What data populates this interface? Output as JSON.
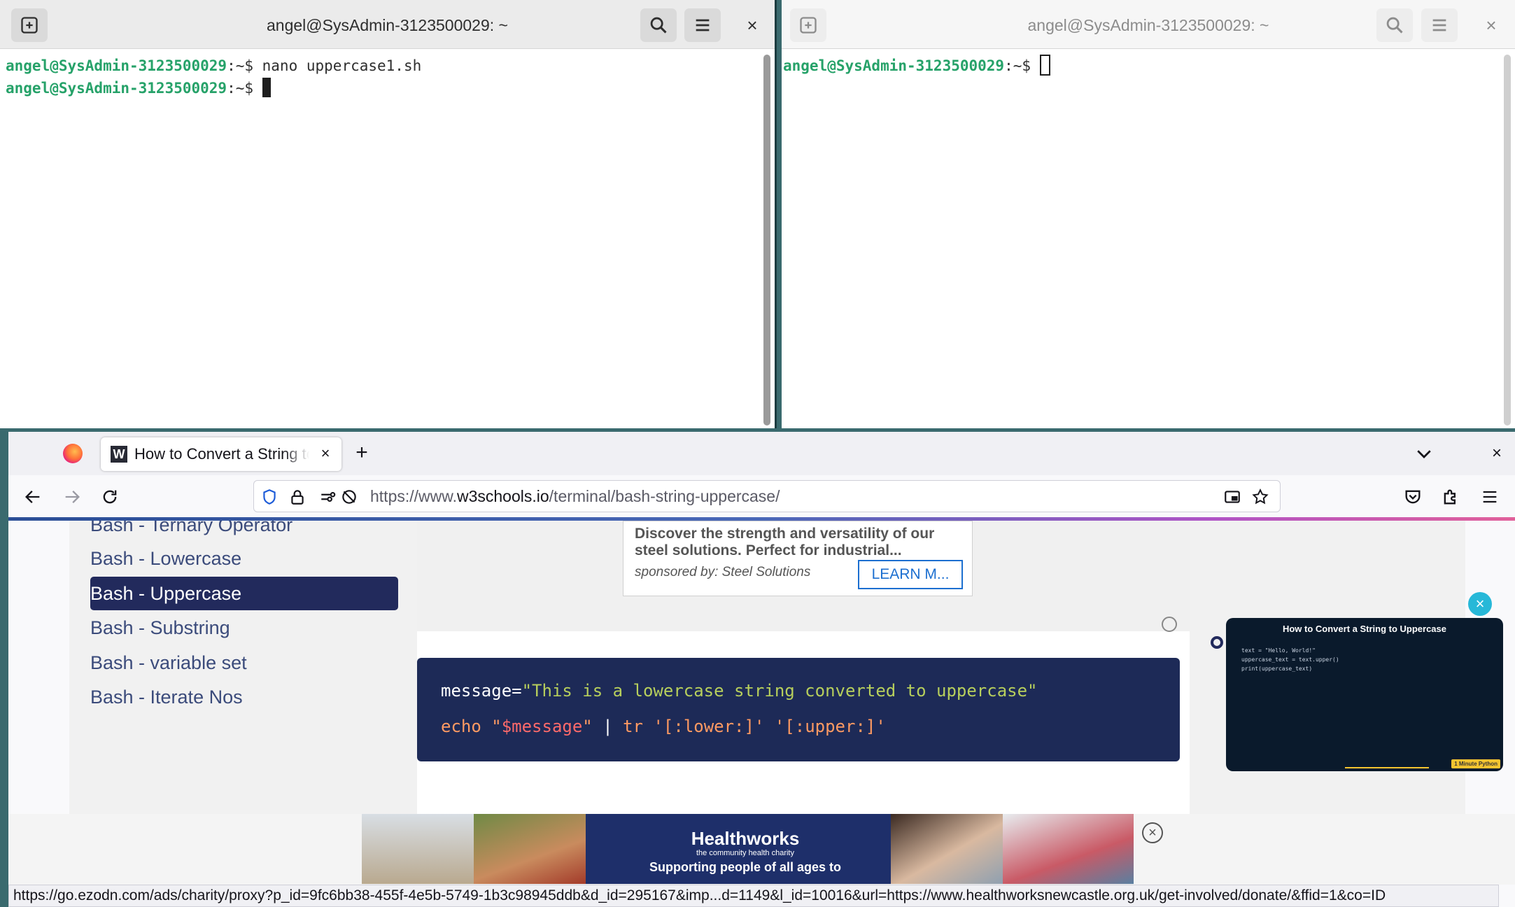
{
  "terminal_left": {
    "title": "angel@SysAdmin-3123500029: ~",
    "lines": [
      {
        "user": "angel@SysAdmin-3123500029",
        "rest": ":~$ nano uppercase1.sh"
      },
      {
        "user": "angel@SysAdmin-3123500029",
        "rest": ":~$ "
      }
    ],
    "close": "×"
  },
  "terminal_right": {
    "title": "angel@SysAdmin-3123500029: ~",
    "lines": [
      {
        "user": "angel@SysAdmin-3123500029",
        "rest": ":~$ "
      }
    ],
    "close": "×"
  },
  "browser": {
    "tab": {
      "favicon": "W",
      "title": "How to Convert a String to Uppercase",
      "close": "×"
    },
    "newtab": "+",
    "window_close": "×",
    "url": {
      "prefix": "https://www.",
      "host": "w3schools.io",
      "path": "/terminal/bash-string-uppercase/"
    },
    "sidebar": {
      "items": [
        {
          "label": "Bash - Ternary Operator"
        },
        {
          "label": "Bash - Lowercase"
        },
        {
          "label": "Bash - Uppercase"
        },
        {
          "label": "Bash - Substring"
        },
        {
          "label": "Bash - variable set"
        },
        {
          "label": "Bash - Iterate Nos"
        }
      ],
      "active_index": 2
    },
    "ad": {
      "description": "Discover the strength and versatility of our steel solutions. Perfect for industrial...",
      "sponsor": "sponsored by: Steel Solutions",
      "button": "LEARN M..."
    },
    "code": {
      "line1": {
        "var": "message=",
        "str": "\"This is a lowercase string converted to uppercase\""
      },
      "line2": {
        "echo": "echo",
        "q1": " \"",
        "var": "$message",
        "q2": "\"",
        "pipe": " | ",
        "tr": "tr",
        "args": " '[:lower:]' '[:upper:]'"
      }
    },
    "video": {
      "title": "How to Convert a String to Uppercase",
      "code": "text = \"Hello, World!\"\nuppercase_text = text.upper()\nprint(uppercase_text)",
      "badge": "1 Minute Python",
      "close": "×"
    },
    "banner": {
      "brand": "Healthworks",
      "sub": "the community health charity",
      "text": "Supporting people of all ages to",
      "close": "×"
    },
    "status_url": "https://go.ezodn.com/ads/charity/proxy?p_id=9fc6bb38-455f-4e5b-5749-1b3c98945ddb&d_id=295167&imp...d=1149&l_id=10016&url=https://www.healthworksnewcastle.org.uk/get-involved/donate/&ffid=1&co=ID"
  },
  "colors": {
    "prompt_green": "#26a269",
    "active_nav": "#222a5c",
    "code_bg": "#1d2a57",
    "code_string": "#b7cf5c",
    "code_keyword": "#ff9a62",
    "code_variable": "#ff6a6a"
  }
}
